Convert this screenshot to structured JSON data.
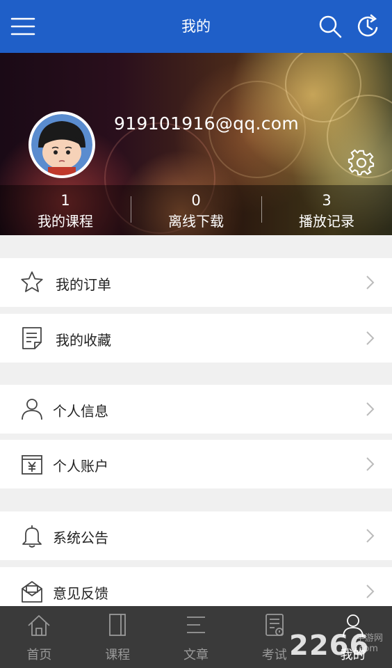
{
  "header": {
    "title": "我的",
    "menu_icon": "menu-icon",
    "search_icon": "search-icon",
    "history_icon": "history-icon"
  },
  "profile": {
    "email": "919101916@qq.com",
    "stats": [
      {
        "count": "1",
        "label": "我的课程"
      },
      {
        "count": "0",
        "label": "离线下载"
      },
      {
        "count": "3",
        "label": "播放记录"
      }
    ]
  },
  "menu": [
    {
      "label": "我的订单",
      "icon": "star-icon"
    },
    {
      "label": "我的收藏",
      "icon": "document-icon"
    },
    {
      "label": "个人信息",
      "icon": "user-icon"
    },
    {
      "label": "个人账户",
      "icon": "wallet-icon"
    },
    {
      "label": "系统公告",
      "icon": "bell-icon"
    },
    {
      "label": "意见反馈",
      "icon": "envelope-icon"
    }
  ],
  "bottom_nav": [
    {
      "label": "首页",
      "icon": "home-icon"
    },
    {
      "label": "课程",
      "icon": "book-icon"
    },
    {
      "label": "文章",
      "icon": "list-icon"
    },
    {
      "label": "考试",
      "icon": "exam-icon"
    },
    {
      "label": "我的",
      "icon": "profile-icon",
      "active": true
    }
  ],
  "watermark": {
    "text": "2266",
    "sub1": "手游网",
    "sub2": ".com"
  },
  "colors": {
    "primary": "#1f5fc8",
    "nav_bg": "#3a3a3a",
    "page_bg": "#f0f0f0"
  }
}
